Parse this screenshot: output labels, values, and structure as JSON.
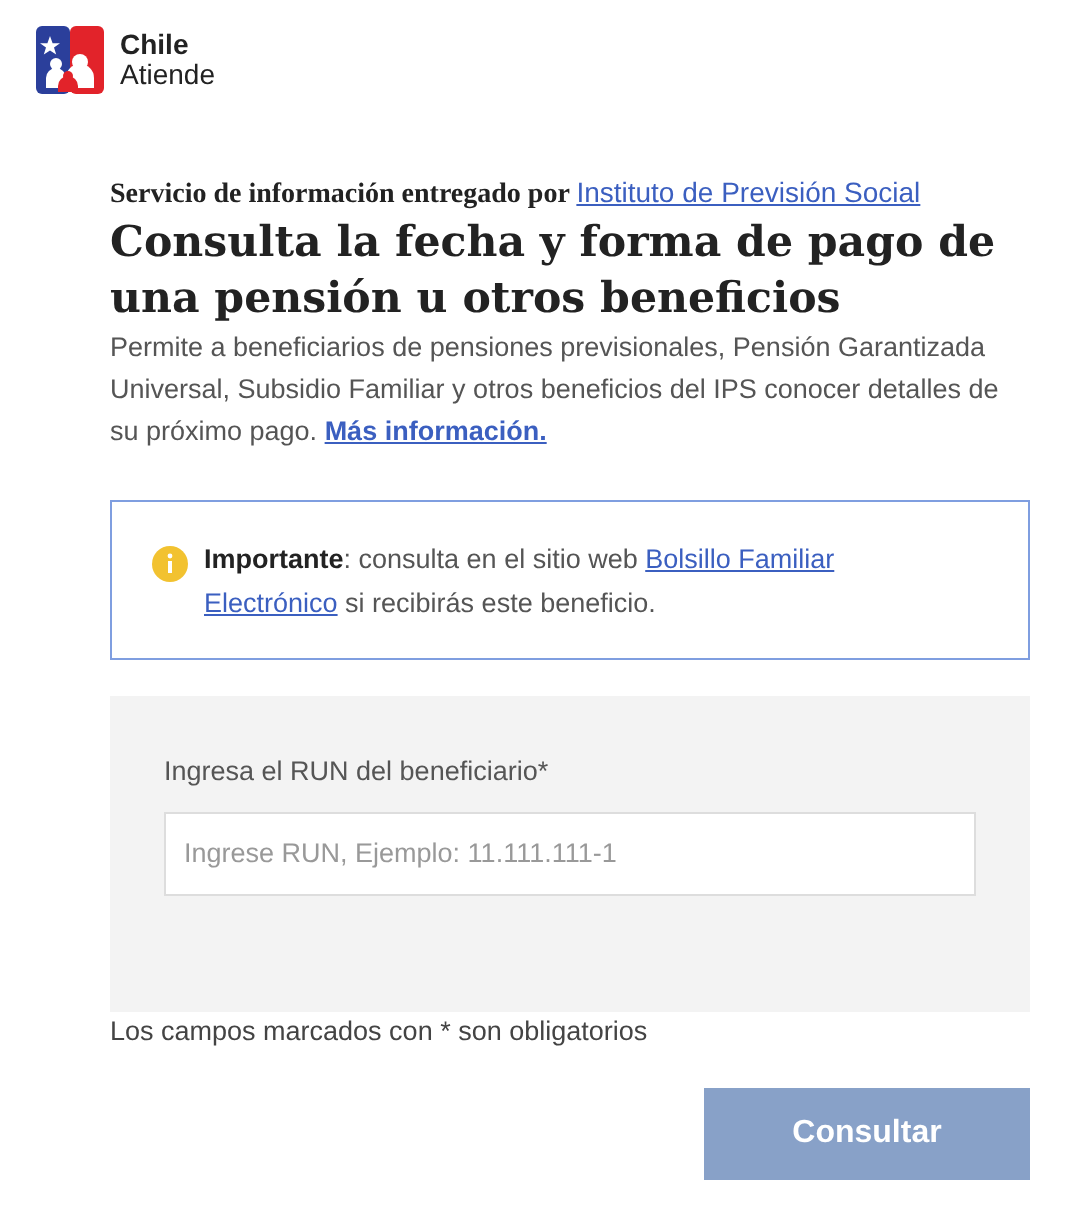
{
  "header": {
    "logo_line_1": "Chile",
    "logo_line_2": "Atiende"
  },
  "provider": {
    "text": "Servicio de información entregado por",
    "link": "Instituto de Previsión Social"
  },
  "title": "Consulta la fecha y forma de pago de una pensión u otros beneficios",
  "intro": {
    "text": "Permite a beneficiarios de pensiones previsionales, Pensión Garantizada Universal, Subsidio Familiar y otros beneficios del IPS conocer detalles de su próximo pago.",
    "link": "Más información."
  },
  "notice": {
    "text": "**Importante**: consulta en el sitio web",
    "links": [
      "Bolsillo Familiar",
      "Electrónico"
    ],
    "text_after": "si recibirás este beneficio."
  },
  "form": {
    "label": "Ingresa el RUN del beneficiario*",
    "placeholder": "Ingrese RUN, Ejemplo: 11.111.111-1"
  },
  "required_note": "Los campos marcados con * son obligatorios",
  "submit": {
    "label": "Consultar",
    "disabled": true
  }
}
